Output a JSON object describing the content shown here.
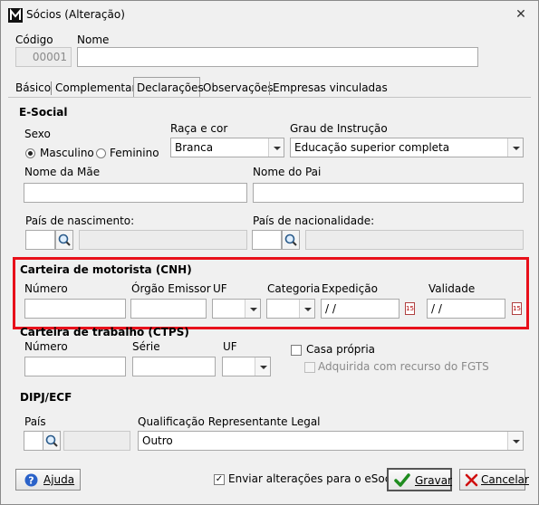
{
  "window": {
    "title": "Sócios (Alteração)"
  },
  "header": {
    "codigo_label": "Código",
    "codigo_value": "00001",
    "nome_label": "Nome",
    "nome_value": ""
  },
  "tabs": [
    {
      "label": "Básico"
    },
    {
      "label": "Complementar"
    },
    {
      "label": "Declarações",
      "selected": true
    },
    {
      "label": "Observações"
    },
    {
      "label": "Empresas vinculadas"
    }
  ],
  "esocial": {
    "title": "E-Social",
    "sexo_label": "Sexo",
    "sexo_options": [
      "Masculino",
      "Feminino"
    ],
    "sexo_selected": "Masculino",
    "raca_label": "Raça e cor",
    "raca_value": "Branca",
    "grau_label": "Grau de Instrução",
    "grau_value": "Educação superior completa",
    "mae_label": "Nome da Mãe",
    "pai_label": "Nome do Pai",
    "pais_nasc_label": "País de nascimento:",
    "pais_nac_label": "País de nacionalidade:"
  },
  "cnh": {
    "title": "Carteira de motorista (CNH)",
    "numero_label": "Número",
    "orgao_label": "Órgão Emissor",
    "uf_label": "UF",
    "categoria_label": "Categoria",
    "expedicao_label": "Expedição",
    "expedicao_value": " /  /",
    "validade_label": "Validade",
    "validade_value": " /  /"
  },
  "ctps": {
    "title": "Carteira de trabalho (CTPS)",
    "numero_label": "Número",
    "serie_label": "Série",
    "uf_label": "UF",
    "casa_propria_label": "Casa própria",
    "fgts_label": "Adquirida com recurso do FGTS"
  },
  "dipj": {
    "title": "DIPJ/ECF",
    "pais_label": "País",
    "qualificacao_label": "Qualificação Representante Legal",
    "qualificacao_value": "Outro"
  },
  "footer": {
    "ajuda_label": "Ajuda",
    "esocial_check_label": "Enviar alterações para o eSocial",
    "esocial_check_checked": true,
    "gravar_label": "Gravar",
    "cancelar_label": "Cancelar"
  },
  "colors": {
    "highlight": "#e8101a",
    "ok_green": "#1e8c1e",
    "cancel_red": "#d01010"
  }
}
